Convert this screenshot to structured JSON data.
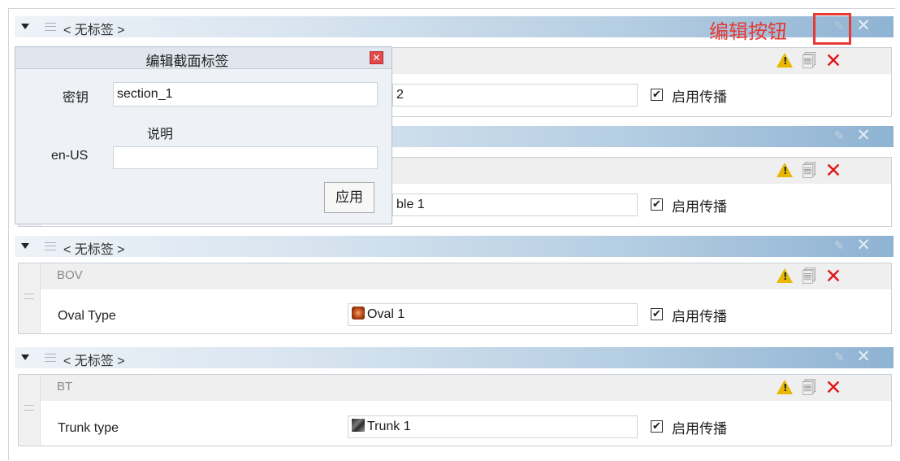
{
  "annotation": {
    "text": "编辑按钮"
  },
  "dialog": {
    "title": "编辑截面标签",
    "close_glyph": "✕",
    "key_label": "密钥",
    "key_value": "section_1",
    "desc_label": "说明",
    "locale_label": "en-US",
    "locale_value": "",
    "apply_label": "应用"
  },
  "sections": [
    {
      "title": "< 无标签 >",
      "item": {
        "name": "",
        "prop_label": "",
        "value": "2",
        "enable_label": "启用传播"
      }
    },
    {
      "title": "",
      "item": {
        "name": "",
        "prop_label": "",
        "value": "ble 1",
        "enable_label": "启用传播"
      }
    },
    {
      "title": "< 无标签 >",
      "item": {
        "name": "BOV",
        "prop_label": "Oval Type",
        "value": "Oval 1",
        "value_icon": "oval-icon",
        "enable_label": "启用传播"
      }
    },
    {
      "title": "< 无标签 >",
      "item": {
        "name": "BT",
        "prop_label": "Trunk type",
        "value": "Trunk 1",
        "value_icon": "trunk-icon",
        "enable_label": "启用传播"
      }
    }
  ],
  "icons": {
    "expand": "triangle-down-icon",
    "grip": "drag-grip-icon",
    "edit": "pencil-icon",
    "delete_section": "close-icon",
    "warning": "warning-icon",
    "notes": "notes-icon",
    "delete_item": "red-x-icon"
  },
  "glyphs": {
    "warn": "!",
    "pencil": "✎",
    "x": "✕",
    "redx": "✕",
    "doc": "🗐",
    "check": "✔"
  },
  "colors": {
    "accent_red": "#e53935",
    "header_blue": "#8fb3d3",
    "warning_yellow": "#e8b800"
  }
}
